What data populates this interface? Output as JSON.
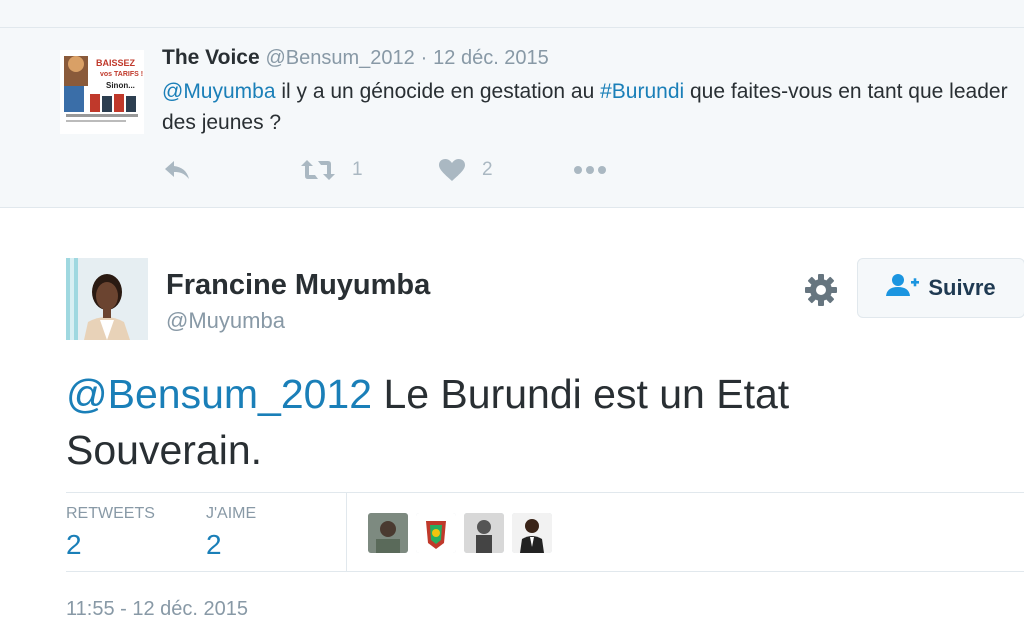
{
  "parent_tweet": {
    "author_name": "The Voice",
    "author_handle": "@Bensum_2012",
    "separator": "·",
    "date": "12 déc. 2015",
    "mention": "@Muyumba",
    "text_part1": " il y a un génocide en gestation au ",
    "hashtag": "#Burundi",
    "text_part2": " que faites-vous en tant que leader des jeunes ?",
    "retweet_count": "1",
    "like_count": "2",
    "avatar_text": {
      "line1": "BAISSEZ",
      "line2": "vos TARIFS !",
      "line3": "Sinon..."
    }
  },
  "main_tweet": {
    "author_name": "Francine Muyumba",
    "author_handle": "@Muyumba",
    "follow_label": "Suivre",
    "mention": "@Bensum_2012",
    "text": " Le Burundi est un Etat Souverain.",
    "retweets_label": "RETWEETS",
    "retweets_count": "2",
    "likes_label": "J'AIME",
    "likes_count": "2",
    "timestamp": "11:55 - 12 déc. 2015"
  },
  "icons": {
    "reply": "reply-icon",
    "retweet": "retweet-icon",
    "like": "heart-icon",
    "more": "more-icon",
    "gear": "gear-icon",
    "follow": "add-user-icon"
  },
  "colors": {
    "link": "#1a7fb8",
    "muted": "#8899a6",
    "icon": "#aab8c2",
    "text": "#292f33",
    "panel": "#f5f8fa"
  }
}
